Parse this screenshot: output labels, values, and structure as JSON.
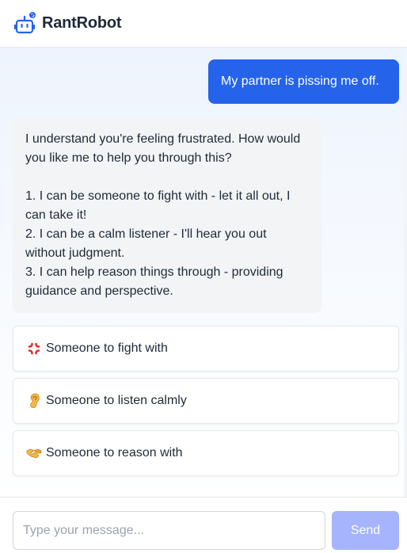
{
  "header": {
    "brand": "RantRobot",
    "logo_icon": "robot-icon",
    "accent_color": "#2563eb"
  },
  "messages": {
    "user": "My partner is pissing me off.",
    "bot": "I understand you're feeling frustrated. How would you like me to help you through this?\n\n1. I can be someone to fight with - let it all out, I can take it!\n2. I can be a calm listener - I'll hear you out without judgment.\n3. I can help reason things through - providing guidance and perspective."
  },
  "options": [
    {
      "icon": "anger-symbol-icon",
      "label": "Someone to fight with"
    },
    {
      "icon": "ear-icon",
      "label": "Someone to listen calmly"
    },
    {
      "icon": "handshake-icon",
      "label": "Someone to reason with"
    }
  ],
  "composer": {
    "placeholder": "Type your message...",
    "send_label": "Send",
    "send_color": "#a5b4fc"
  }
}
